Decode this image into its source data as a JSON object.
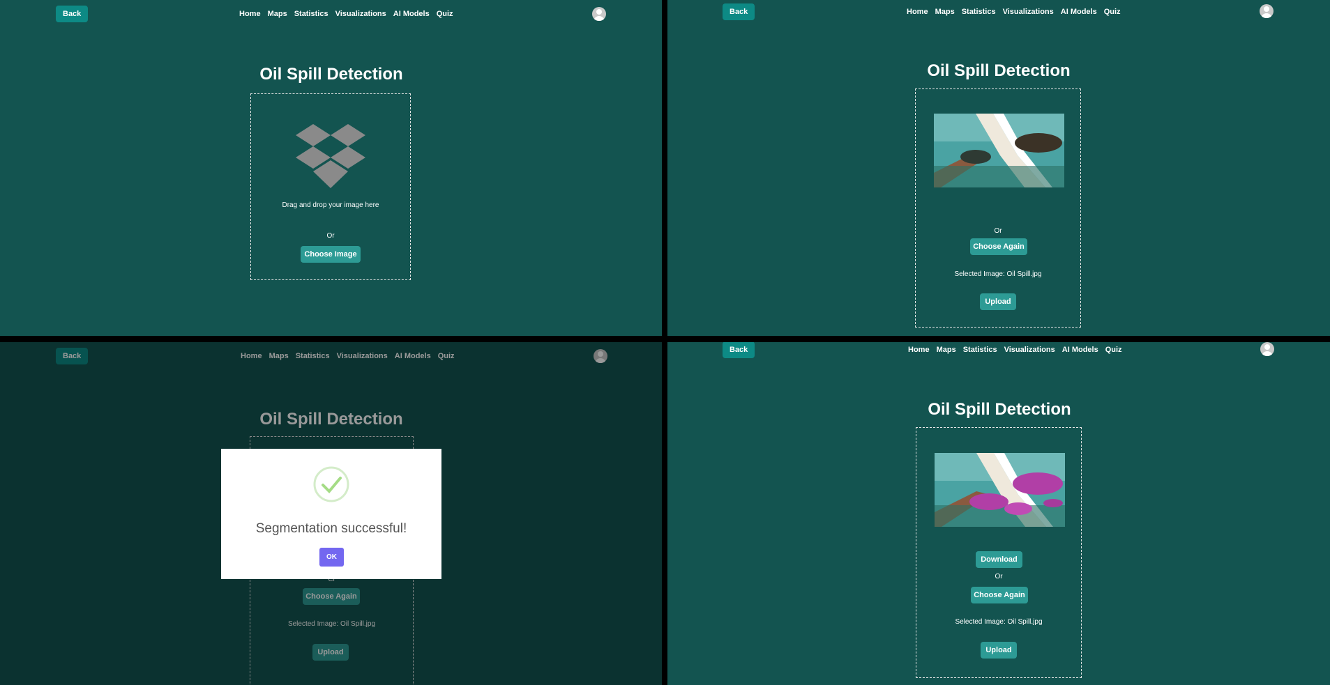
{
  "nav": {
    "back": "Back",
    "links": [
      "Home",
      "Maps",
      "Statistics",
      "Visualizations",
      "AI Models",
      "Quiz"
    ]
  },
  "title": "Oil Spill Detection",
  "upload_panel": {
    "drag_text": "Drag and drop your image here",
    "or": "Or",
    "choose": "Choose Image"
  },
  "selected_panel": {
    "or": "Or",
    "choose_again": "Choose Again",
    "selected": "Selected Image: Oil Spill.jpg",
    "upload": "Upload"
  },
  "dialog": {
    "message": "Segmentation successful!",
    "ok": "OK",
    "partial_or": "Cr"
  },
  "result_panel": {
    "download": "Download",
    "or": "Or",
    "choose_again": "Choose Again",
    "selected": "Selected Image: Oil Spill.jpg",
    "upload": "Upload"
  },
  "icons": [
    "dropbox-icon",
    "avatar-icon",
    "success-check-icon"
  ],
  "colors": {
    "background": "#135450",
    "button": "#2d9b95",
    "back_button": "#0d8a85",
    "ok_button": "#7367f0"
  }
}
